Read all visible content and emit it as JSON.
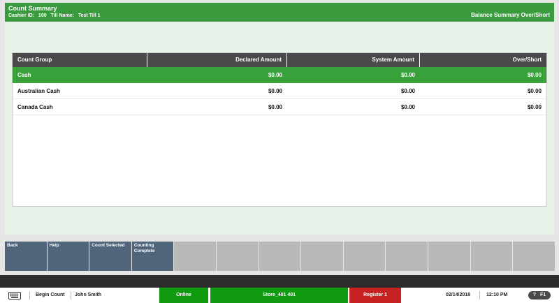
{
  "header": {
    "title": "Count Summary",
    "cashier_label": "Cashier ID:",
    "cashier_id": "100",
    "till_label": "Till Name:",
    "till_name": "Test Till 1",
    "right_title": "Balance Summary Over/Short"
  },
  "table": {
    "columns": [
      "Count Group",
      "Declared Amount",
      "System Amount",
      "Over/Short"
    ],
    "rows": [
      {
        "group": "Cash",
        "declared": "$0.00",
        "system": "$0.00",
        "over_short": "$0.00",
        "selected": true
      },
      {
        "group": "Australian Cash",
        "declared": "$0.00",
        "system": "$0.00",
        "over_short": "$0.00",
        "selected": false
      },
      {
        "group": "Canada Cash",
        "declared": "$0.00",
        "system": "$0.00",
        "over_short": "$0.00",
        "selected": false
      }
    ]
  },
  "function_keys": [
    {
      "label": "Back",
      "active": true
    },
    {
      "label": "Help",
      "active": true
    },
    {
      "label": "Count Selected",
      "active": true
    },
    {
      "label": "Counting Complete",
      "active": true
    },
    {
      "label": "",
      "active": false
    },
    {
      "label": "",
      "active": false
    },
    {
      "label": "",
      "active": false
    },
    {
      "label": "",
      "active": false
    },
    {
      "label": "",
      "active": false
    },
    {
      "label": "",
      "active": false
    },
    {
      "label": "",
      "active": false
    },
    {
      "label": "",
      "active": false
    },
    {
      "label": "",
      "active": false
    }
  ],
  "status_bar": {
    "keyboard_icon": "keyboard-icon",
    "mode": "Begin Count",
    "user": "John Smith",
    "connection": "Online",
    "store": "Store_401 401",
    "register": "Register 1",
    "date": "02/14/2018",
    "time": "12:10 PM",
    "help_key": "F1",
    "help_icon": "question-icon"
  },
  "colors": {
    "header_green": "#3a9a3e",
    "selected_row": "#39a13a",
    "function_key_active": "#50657a",
    "status_green": "#109a10",
    "status_red": "#c62222"
  }
}
